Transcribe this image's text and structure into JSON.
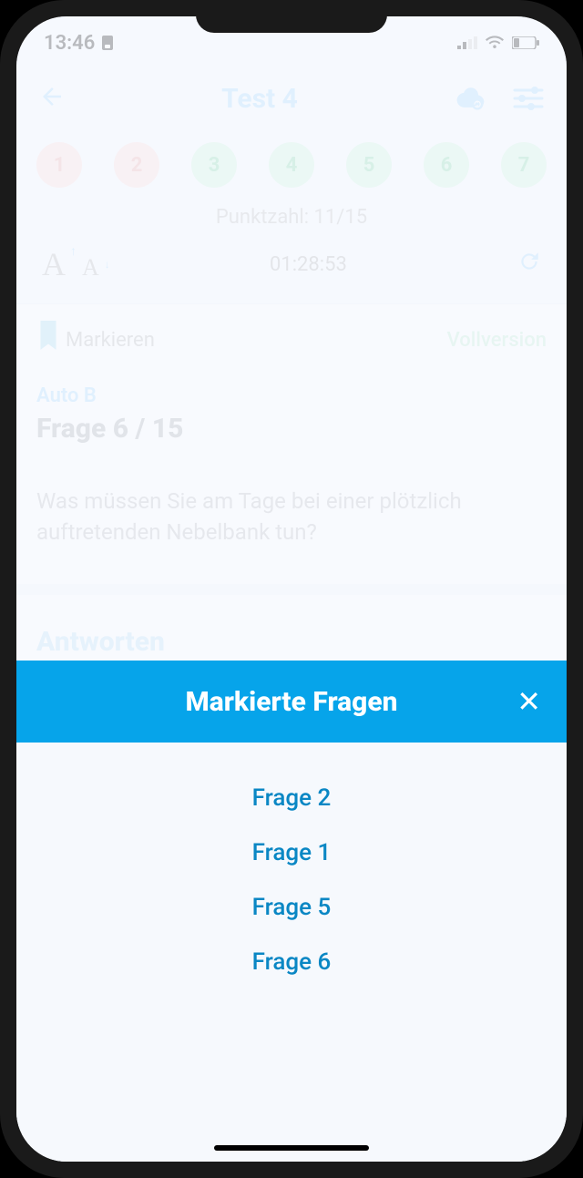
{
  "status": {
    "time": "13:46"
  },
  "header": {
    "title": "Test 4"
  },
  "bubbles": [
    "1",
    "2",
    "3",
    "4",
    "5",
    "6",
    "7"
  ],
  "score_label": "Punktzahl: 11/15",
  "timer": "01:28:53",
  "mark": {
    "label": "Markieren",
    "full": "Vollversion"
  },
  "question": {
    "category": "Auto B",
    "counter": "Frage 6 / 15",
    "text": "Was müssen Sie am Tage bei einer plötzlich auftretenden Nebelbank tun?"
  },
  "answers_heading": "Antworten",
  "modal": {
    "title": "Markierte Fragen",
    "items": [
      "Frage 2",
      "Frage 1",
      "Frage 5",
      "Frage 6"
    ]
  }
}
